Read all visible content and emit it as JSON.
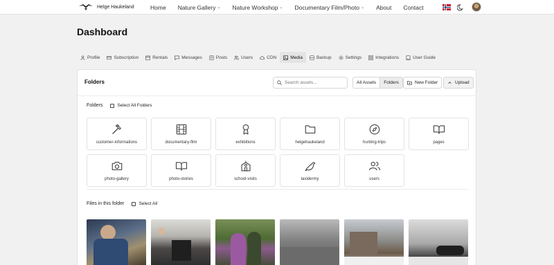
{
  "nav": {
    "brand": "Helge Haukeland",
    "links": [
      {
        "label": "Home",
        "has_dropdown": false
      },
      {
        "label": "Nature Gallery",
        "has_dropdown": true
      },
      {
        "label": "Nature Workshop",
        "has_dropdown": true
      },
      {
        "label": "Documentary Film/Photo",
        "has_dropdown": true
      },
      {
        "label": "About",
        "has_dropdown": false
      },
      {
        "label": "Contact",
        "has_dropdown": false
      }
    ],
    "dropdown_glyph": "⌄"
  },
  "page": {
    "title": "Dashboard"
  },
  "tabs": [
    {
      "label": "Profile",
      "icon": "user-icon"
    },
    {
      "label": "Subscription",
      "icon": "card-icon"
    },
    {
      "label": "Rentals",
      "icon": "calendar-icon"
    },
    {
      "label": "Messages",
      "icon": "message-icon"
    },
    {
      "label": "Posts",
      "icon": "document-icon"
    },
    {
      "label": "Users",
      "icon": "users-icon"
    },
    {
      "label": "CDN",
      "icon": "cloud-icon"
    },
    {
      "label": "Media",
      "icon": "image-icon",
      "active": true
    },
    {
      "label": "Backup",
      "icon": "database-icon"
    },
    {
      "label": "Settings",
      "icon": "gear-icon"
    },
    {
      "label": "Integrations",
      "icon": "grid-icon"
    },
    {
      "label": "User Guide",
      "icon": "book-icon"
    }
  ],
  "media": {
    "title": "Folders",
    "search_placeholder": "Search assets...",
    "view_all_assets": "All Assets",
    "view_folders": "Folders",
    "new_folder": "New Folder",
    "upload": "Upload",
    "folders_section": "Folders",
    "select_all_folders": "Select All Folders",
    "files_section": "Files in this folder",
    "select_all": "Select All",
    "folders": [
      {
        "name": "customer-informations",
        "icon": "hammer-icon"
      },
      {
        "name": "documentary-film",
        "icon": "film-icon"
      },
      {
        "name": "exhibitions",
        "icon": "award-icon"
      },
      {
        "name": "helgehaukeland",
        "icon": "folder-icon"
      },
      {
        "name": "hunting-trips",
        "icon": "compass-icon"
      },
      {
        "name": "pages",
        "icon": "book-open-icon"
      },
      {
        "name": "photo-gallery",
        "icon": "camera-icon"
      },
      {
        "name": "photo-stories",
        "icon": "book-open-icon"
      },
      {
        "name": "school-visits",
        "icon": "school-icon"
      },
      {
        "name": "taxidermy",
        "icon": "bird-icon"
      },
      {
        "name": "users",
        "icon": "users-icon"
      }
    ]
  },
  "colors": {
    "accent": "#111111",
    "border": "#e2e2e2",
    "background": "#f1f1f1"
  }
}
